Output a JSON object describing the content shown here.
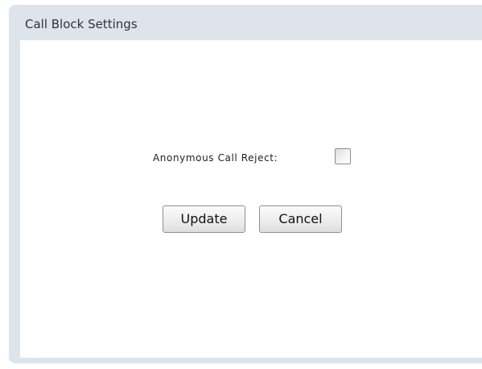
{
  "panel": {
    "title": "Call Block Settings"
  },
  "settings": {
    "anonymous_call_reject": {
      "label": "Anonymous Call Reject:",
      "checked": false
    }
  },
  "buttons": {
    "update_label": "Update",
    "cancel_label": "Cancel"
  }
}
